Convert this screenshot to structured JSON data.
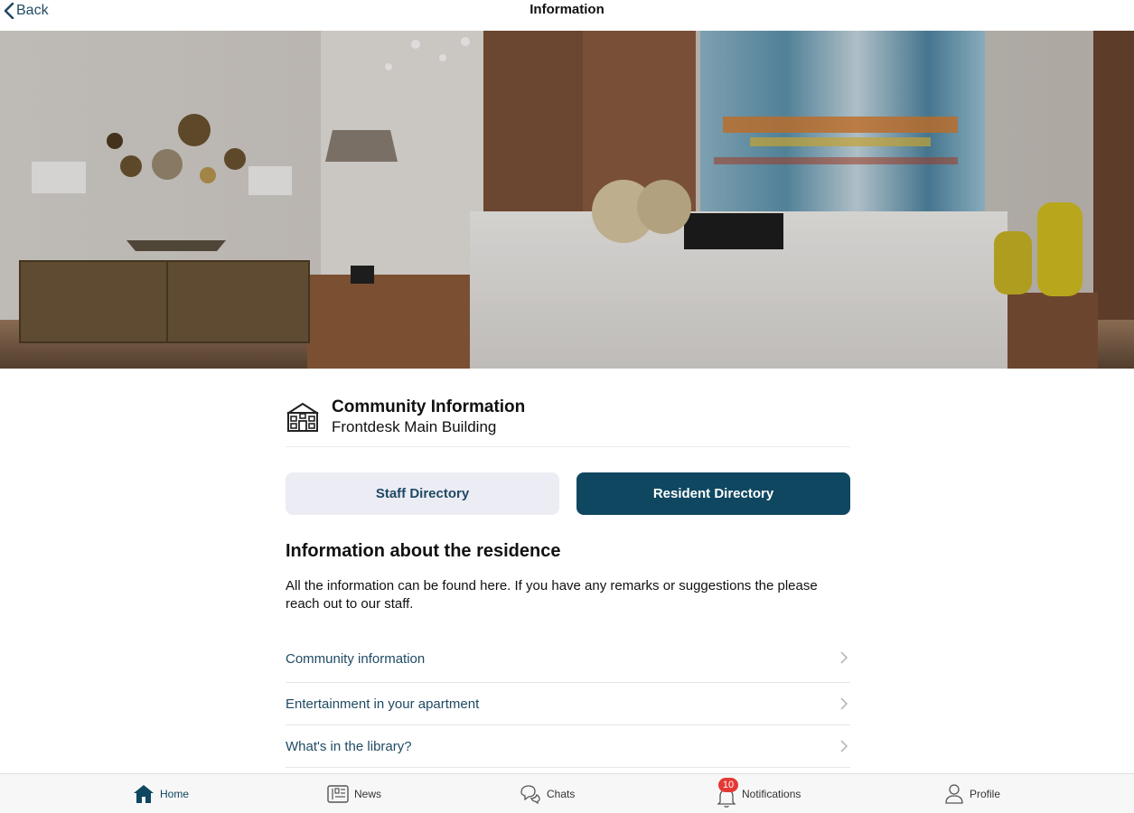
{
  "nav": {
    "back_label": "Back",
    "title": "Information"
  },
  "community": {
    "title": "Community Information",
    "subtitle": "Frontdesk Main Building"
  },
  "directories": {
    "staff_label": "Staff Directory",
    "resident_label": "Resident Directory"
  },
  "residence": {
    "heading": "Information about the residence",
    "description": "All the information can be found here. If you have any remarks or suggestions the please reach out to our staff."
  },
  "info_items": [
    "Community information",
    "Entertainment in your apartment",
    "What's in the library?"
  ],
  "tabbar": {
    "home": "Home",
    "news": "News",
    "chats": "Chats",
    "notifications": "Notifications",
    "notifications_badge": "10",
    "profile": "Profile"
  },
  "colors": {
    "accent": "#0f4761",
    "link": "#1f4a63",
    "light_button": "#ececf5",
    "badge": "#e53935"
  }
}
